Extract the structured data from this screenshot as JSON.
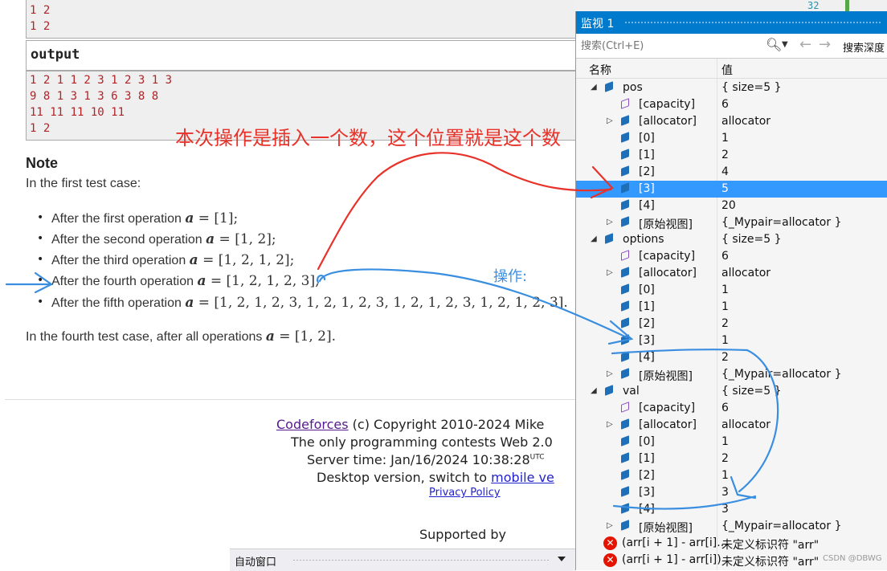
{
  "problem": {
    "input_tail": [
      "1 2",
      "1 2"
    ],
    "output_label": "output",
    "output_lines": [
      "1 2 1 1 2 3 1 2 3 1 3",
      "9 8 1 3 1 3 6 3 8 8",
      "11 11 11 10 11",
      "1 2"
    ],
    "note_title": "Note",
    "first_case": "In the first test case:",
    "operations": [
      {
        "text": "After the first operation ",
        "math": "= [1];"
      },
      {
        "text": "After the second operation ",
        "math": "= [1, 2];"
      },
      {
        "text": "After the third operation ",
        "math": "= [1, 2, 1, 2];"
      },
      {
        "text": "After the fourth operation ",
        "math": "= [1, 2, 1, 2, 3];"
      },
      {
        "text": "After the fifth operation ",
        "math": "= [1, 2, 1, 2, 3, 1, 2, 1, 2, 3, 1, 2, 1, 2, 3, 1, 2, 1, 2, 3]."
      }
    ],
    "math_var": "a",
    "fourth_case_text": "In the fourth test case, after all operations ",
    "fourth_case_math": "= [1, 2]."
  },
  "footer": {
    "codeforces_link": "Codeforces",
    "copyright": " (c) Copyright 2010-2024 Mike",
    "line2": "The only programming contests Web 2.0",
    "server_time": "Server time: Jan/16/2024 10:38:28",
    "utc": "UTC",
    "desktop_prefix": "Desktop version, switch to ",
    "mobile_link": "mobile ve",
    "privacy": "Privacy Policy",
    "supported_by": "Supported by"
  },
  "taskbar": {
    "auto_window": "自动窗口"
  },
  "watch": {
    "title": "监视 1",
    "search_placeholder": "搜索(Ctrl+E)",
    "search_depth": "搜索深度",
    "col_name": "名称",
    "col_value": "值",
    "line_number": "32",
    "rows": [
      {
        "name": "pos",
        "value": "{ size=5 }",
        "level": 0,
        "expander": "open",
        "icon": "cube"
      },
      {
        "name": "[capacity]",
        "value": "6",
        "level": 1,
        "expander": "none",
        "icon": "hollow-cube"
      },
      {
        "name": "[allocator]",
        "value": "allocator",
        "level": 1,
        "expander": "closed",
        "icon": "cube"
      },
      {
        "name": "[0]",
        "value": "1",
        "level": 1,
        "expander": "none",
        "icon": "cube"
      },
      {
        "name": "[1]",
        "value": "2",
        "level": 1,
        "expander": "none",
        "icon": "cube"
      },
      {
        "name": "[2]",
        "value": "4",
        "level": 1,
        "expander": "none",
        "icon": "cube"
      },
      {
        "name": "[3]",
        "value": "5",
        "level": 1,
        "expander": "none",
        "icon": "cube",
        "selected": true
      },
      {
        "name": "[4]",
        "value": "20",
        "level": 1,
        "expander": "none",
        "icon": "cube"
      },
      {
        "name": "[原始视图]",
        "value": "{_Mypair=allocator }",
        "level": 1,
        "expander": "closed",
        "icon": "cube"
      },
      {
        "name": "options",
        "value": "{ size=5 }",
        "level": 0,
        "expander": "open",
        "icon": "cube"
      },
      {
        "name": "[capacity]",
        "value": "6",
        "level": 1,
        "expander": "none",
        "icon": "hollow-cube"
      },
      {
        "name": "[allocator]",
        "value": "allocator",
        "level": 1,
        "expander": "closed",
        "icon": "cube"
      },
      {
        "name": "[0]",
        "value": "1",
        "level": 1,
        "expander": "none",
        "icon": "cube"
      },
      {
        "name": "[1]",
        "value": "1",
        "level": 1,
        "expander": "none",
        "icon": "cube"
      },
      {
        "name": "[2]",
        "value": "2",
        "level": 1,
        "expander": "none",
        "icon": "cube"
      },
      {
        "name": "[3]",
        "value": "1",
        "level": 1,
        "expander": "none",
        "icon": "cube"
      },
      {
        "name": "[4]",
        "value": "2",
        "level": 1,
        "expander": "none",
        "icon": "cube"
      },
      {
        "name": "[原始视图]",
        "value": "{_Mypair=allocator }",
        "level": 1,
        "expander": "closed",
        "icon": "cube"
      },
      {
        "name": "val",
        "value": "{ size=5 }",
        "level": 0,
        "expander": "open",
        "icon": "cube"
      },
      {
        "name": "[capacity]",
        "value": "6",
        "level": 1,
        "expander": "none",
        "icon": "hollow-cube"
      },
      {
        "name": "[allocator]",
        "value": "allocator",
        "level": 1,
        "expander": "closed",
        "icon": "cube"
      },
      {
        "name": "[0]",
        "value": "1",
        "level": 1,
        "expander": "none",
        "icon": "cube"
      },
      {
        "name": "[1]",
        "value": "2",
        "level": 1,
        "expander": "none",
        "icon": "cube"
      },
      {
        "name": "[2]",
        "value": "1",
        "level": 1,
        "expander": "none",
        "icon": "cube"
      },
      {
        "name": "[3]",
        "value": "3",
        "level": 1,
        "expander": "none",
        "icon": "cube"
      },
      {
        "name": "[4]",
        "value": "3",
        "level": 1,
        "expander": "none",
        "icon": "cube"
      },
      {
        "name": "[原始视图]",
        "value": "{_Mypair=allocator }",
        "level": 1,
        "expander": "closed",
        "icon": "cube"
      },
      {
        "name": "(arr[i + 1] - arr[i]...",
        "value": "未定义标识符 \"arr\"",
        "level": 0,
        "expander": "none",
        "icon": "error"
      },
      {
        "name": "(arr[i + 1] - arr[i])",
        "value": "未定义标识符 \"arr\"",
        "level": 0,
        "expander": "none",
        "icon": "error"
      }
    ]
  },
  "annotations": {
    "red_text": "本次操作是插入一个数，这个位置就是这个数",
    "blue_text": "操作:",
    "red_color": "#e8322a",
    "blue_color": "#3a8ee0"
  },
  "watermark": "CSDN @DBWG"
}
